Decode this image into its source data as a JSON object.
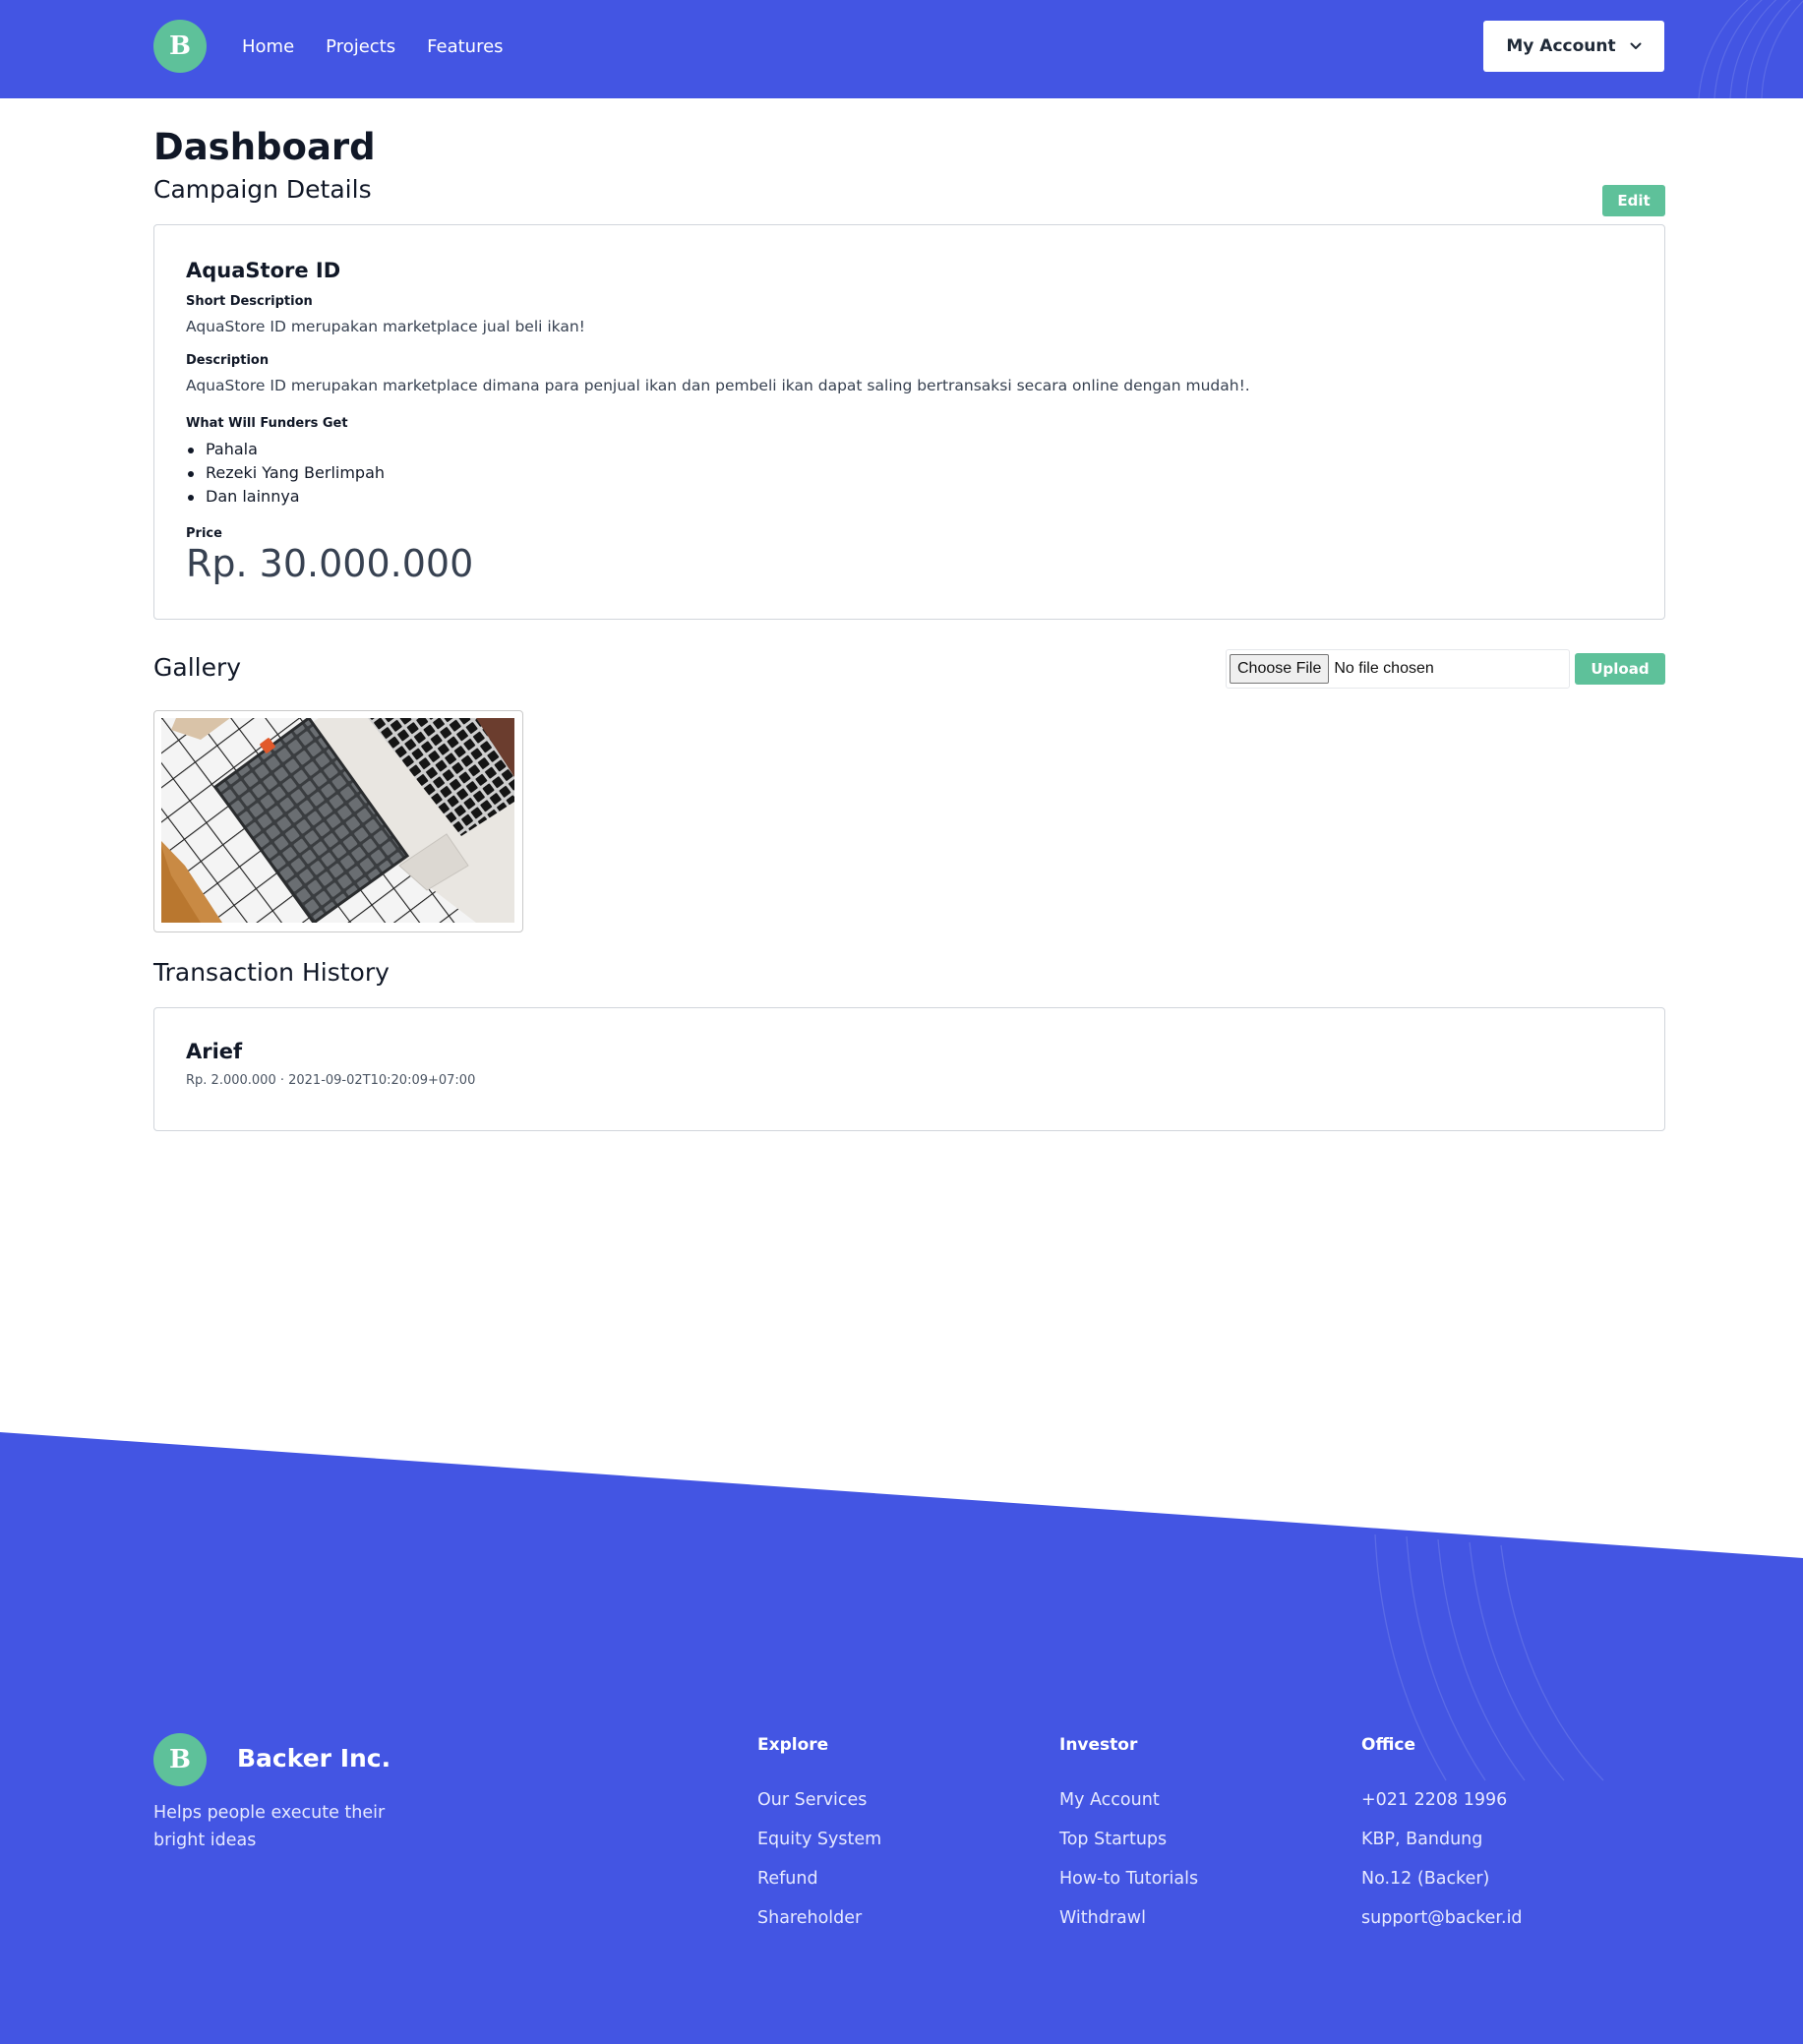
{
  "header": {
    "logo_letter": "B",
    "nav": [
      "Home",
      "Projects",
      "Features"
    ],
    "account_label": "My Account"
  },
  "page": {
    "title": "Dashboard",
    "campaign_section_title": "Campaign Details",
    "edit_label": "Edit"
  },
  "campaign": {
    "name": "AquaStore ID",
    "short_description_label": "Short Description",
    "short_description": "AquaStore ID merupakan marketplace jual beli ikan!",
    "description_label": "Description",
    "description": "AquaStore ID merupakan marketplace dimana para penjual ikan dan pembeli ikan dapat saling bertransaksi secara online dengan mudah!.",
    "perks_label": "What Will Funders Get",
    "perks": [
      "Pahala",
      "Rezeki Yang Berlimpah",
      "Dan lainnya"
    ],
    "price_label": "Price",
    "price": "Rp. 30.000.000"
  },
  "gallery": {
    "title": "Gallery",
    "choose_file_label": "Choose File",
    "file_status": "No file chosen",
    "upload_label": "Upload"
  },
  "transactions": {
    "title": "Transaction History",
    "items": [
      {
        "name": "Arief",
        "meta": "Rp. 2.000.000 · 2021-09-02T10:20:09+07:00"
      }
    ]
  },
  "footer": {
    "brand": "Backer Inc.",
    "tagline": "Helps people execute their bright ideas",
    "columns": [
      {
        "title": "Explore",
        "links": [
          "Our Services",
          "Equity System",
          "Refund",
          "Shareholder"
        ]
      },
      {
        "title": "Investor",
        "links": [
          "My Account",
          "Top Startups",
          "How-to Tutorials",
          "Withdrawl"
        ]
      },
      {
        "title": "Office",
        "links": [
          "+021 2208 1996",
          "KBP, Bandung",
          "No.12 (Backer)",
          "support@backer.id"
        ]
      }
    ]
  },
  "colors": {
    "brand_blue": "#4355e3",
    "accent_green": "#5ec19a"
  },
  "icons": {
    "account_chevron": "chevron-down-icon"
  }
}
